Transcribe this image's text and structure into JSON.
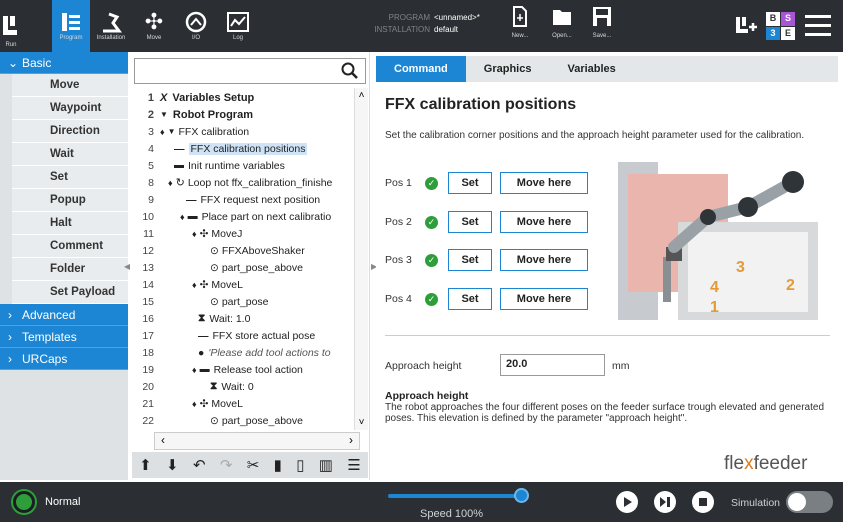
{
  "header": {
    "nav": [
      {
        "label": "Run"
      },
      {
        "label": "Program"
      },
      {
        "label": "Installation"
      },
      {
        "label": "Move"
      },
      {
        "label": "I/O"
      },
      {
        "label": "Log"
      }
    ],
    "program_key": "PROGRAM",
    "program_value": "<unnamed>*",
    "installation_key": "INSTALLATION",
    "installation_value": "default",
    "file_buttons": [
      {
        "label": "New..."
      },
      {
        "label": "Open..."
      },
      {
        "label": "Save..."
      }
    ],
    "badge": [
      "B",
      "S",
      "3",
      "E"
    ]
  },
  "categories": {
    "basic": "Basic",
    "commands": [
      "Move",
      "Waypoint",
      "Direction",
      "Wait",
      "Set",
      "Popup",
      "Halt",
      "Comment",
      "Folder",
      "Set Payload"
    ],
    "advanced": "Advanced",
    "templates": "Templates",
    "urcaps": "URCaps"
  },
  "tree": {
    "rows": [
      {
        "num": "1",
        "text": "Variables Setup"
      },
      {
        "num": "2",
        "text": "Robot Program"
      },
      {
        "num": "3",
        "text": "FFX calibration"
      },
      {
        "num": "4",
        "text": "FFX calibration positions"
      },
      {
        "num": "5",
        "text": "Init runtime variables"
      },
      {
        "num": "8",
        "text": "Loop not ffx_calibration_finishe"
      },
      {
        "num": "9",
        "text": "FFX request next position"
      },
      {
        "num": "10",
        "text": "Place part on next calibratio"
      },
      {
        "num": "11",
        "text": "MoveJ"
      },
      {
        "num": "12",
        "text": "FFXAboveShaker"
      },
      {
        "num": "13",
        "text": "part_pose_above"
      },
      {
        "num": "14",
        "text": "MoveL"
      },
      {
        "num": "15",
        "text": "part_pose"
      },
      {
        "num": "16",
        "text": "Wait: 1.0"
      },
      {
        "num": "17",
        "text": "FFX store actual pose"
      },
      {
        "num": "18",
        "text": "'Please add tool actions to"
      },
      {
        "num": "19",
        "text": "Release tool action"
      },
      {
        "num": "20",
        "text": "Wait: 0"
      },
      {
        "num": "21",
        "text": "MoveL"
      },
      {
        "num": "22",
        "text": "part_pose_above"
      }
    ]
  },
  "tabs": [
    "Command",
    "Graphics",
    "Variables"
  ],
  "panel": {
    "title": "FFX calibration positions",
    "description": "Set the calibration corner positions and the approach height parameter used for the calibration.",
    "positions": [
      {
        "label": "Pos 1",
        "set": "Set",
        "move": "Move here"
      },
      {
        "label": "Pos 2",
        "set": "Set",
        "move": "Move here"
      },
      {
        "label": "Pos 3",
        "set": "Set",
        "move": "Move here"
      },
      {
        "label": "Pos 4",
        "set": "Set",
        "move": "Move here"
      }
    ],
    "approach_label": "Approach height",
    "approach_value": "20.0",
    "approach_unit": "mm",
    "approach_title": "Approach height",
    "approach_desc": "The robot approaches the four different poses on the feeder surface trough elevated and generated poses. This elevation is defined by the parameter \"approach height\".",
    "logo_text_a": "fle",
    "logo_text_x": "x",
    "logo_text_b": "feeder",
    "image_numbers": [
      "1",
      "2",
      "3",
      "4"
    ]
  },
  "footer": {
    "status": "Normal",
    "speed": "Speed 100%",
    "speed_fraction": 1.0,
    "simulation": "Simulation"
  },
  "colors": {
    "accent": "#1c86d4",
    "header_bg": "#2b2f33",
    "ok_green": "#2e9e3a",
    "brand_orange": "#e07a1a"
  }
}
